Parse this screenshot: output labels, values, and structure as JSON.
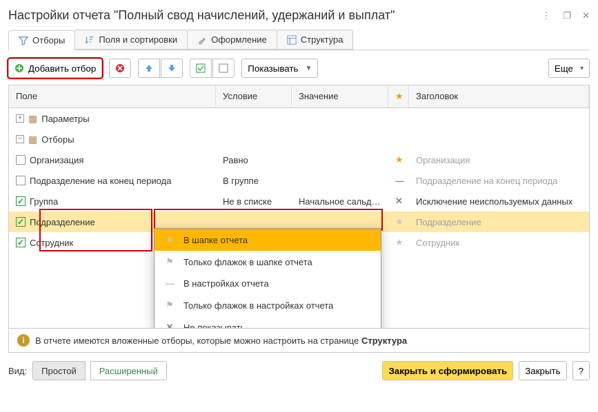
{
  "title": "Настройки отчета \"Полный свод начислений, удержаний и выплат\"",
  "tabs": {
    "filters": "Отборы",
    "fields": "Поля и сортировки",
    "design": "Оформление",
    "structure": "Структура"
  },
  "toolbar": {
    "add_filter": "Добавить отбор",
    "show": "Показывать",
    "more": "Еще"
  },
  "columns": {
    "field": "Поле",
    "condition": "Условие",
    "value": "Значение",
    "title": "Заголовок"
  },
  "tree": {
    "parameters": "Параметры",
    "filters": "Отборы",
    "rows": [
      {
        "label": "Организация",
        "checked": false,
        "cond": "Равно",
        "val": "",
        "star": "star",
        "title": "Организация"
      },
      {
        "label": "Подразделение на конец периода",
        "checked": false,
        "cond": "В группе",
        "val": "",
        "star": "dash",
        "title": "Подразделение на конец периода"
      },
      {
        "label": "Группа",
        "checked": true,
        "cond": "Не в списке",
        "val": "Начальное сальдо…",
        "star": "x",
        "title": "Исключение неиспользуемых данных",
        "title_active": true
      },
      {
        "label": "Подразделение",
        "checked": true,
        "cond": "",
        "val": "",
        "star": "star-gray",
        "title": "Подразделение",
        "selected": true
      },
      {
        "label": "Сотрудник",
        "checked": true,
        "cond": "",
        "val": "",
        "star": "star-gray",
        "title": "Сотрудник"
      }
    ]
  },
  "popup": {
    "items": [
      {
        "icon": "star",
        "label": "В шапке отчета",
        "selected": true
      },
      {
        "icon": "flag",
        "label": "Только флажок в шапке отчета"
      },
      {
        "icon": "dash",
        "label": "В настройках отчета"
      },
      {
        "icon": "flag",
        "label": "Только флажок в настройках отчета"
      },
      {
        "icon": "x",
        "label": "Не показывать"
      }
    ]
  },
  "info": {
    "text_pre": "В отчете имеются вложенные отборы, которые можно настроить на странице ",
    "link": "Структура"
  },
  "bottom": {
    "view": "Вид:",
    "simple": "Простой",
    "advanced": "Расширенный",
    "apply": "Закрыть и сформировать",
    "close": "Закрыть",
    "help": "?"
  }
}
